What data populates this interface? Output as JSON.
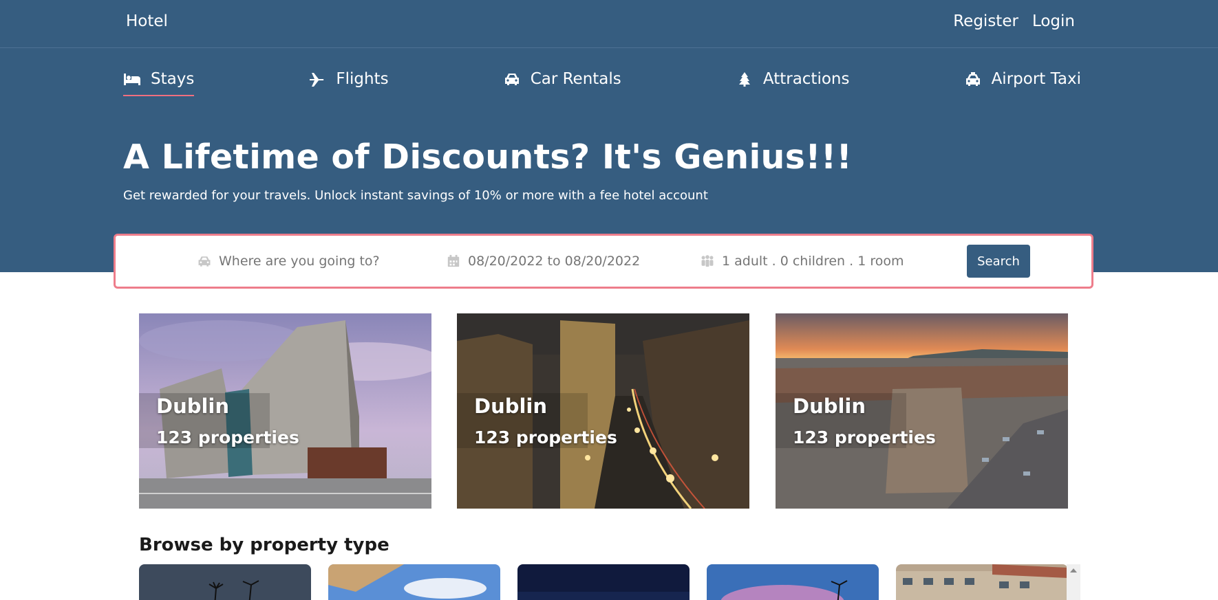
{
  "header": {
    "brand": "Hotel",
    "register": "Register",
    "login": "Login"
  },
  "nav": {
    "items": [
      {
        "label": "Stays",
        "icon": "bed-icon",
        "active": true
      },
      {
        "label": "Flights",
        "icon": "plane-icon",
        "active": false
      },
      {
        "label": "Car Rentals",
        "icon": "car-icon",
        "active": false
      },
      {
        "label": "Attractions",
        "icon": "tree-icon",
        "active": false
      },
      {
        "label": "Airport Taxi",
        "icon": "taxi-icon",
        "active": false
      }
    ]
  },
  "hero": {
    "title": "A Lifetime of Discounts? It's Genius!!!",
    "subtitle": "Get rewarded for your travels. Unlock instant savings of 10% or more with a fee hotel account"
  },
  "search": {
    "destination_placeholder": "Where are you going to?",
    "dates": "08/20/2022 to 08/20/2022",
    "guests": "1 adult . 0 children . 1 room",
    "button": "Search"
  },
  "featured": [
    {
      "city": "Dublin",
      "properties": "123 properties"
    },
    {
      "city": "Dublin",
      "properties": "123 properties"
    },
    {
      "city": "Dublin",
      "properties": "123 properties"
    }
  ],
  "browse": {
    "title": "Browse by property type"
  },
  "colors": {
    "hero_bg": "#365d80",
    "accent": "#ee7d8b",
    "button_bg": "#365d80"
  }
}
